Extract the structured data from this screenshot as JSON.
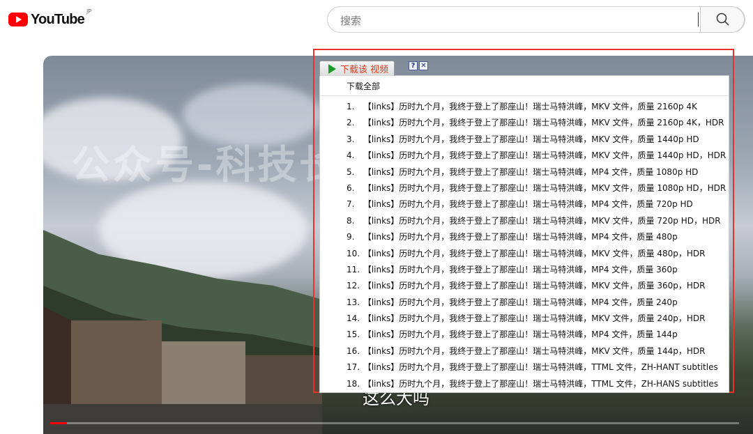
{
  "header": {
    "logo_text": "YouTube",
    "region": "JP",
    "search_placeholder": "搜索",
    "search_icon": "search-icon"
  },
  "video": {
    "watermark": "公众号-科技长青",
    "subtitle": "这么大吗",
    "progress": 0.024
  },
  "download_menu": {
    "title": "下载该 视频",
    "help_label": "?",
    "close_label": "✕",
    "all_label": "下载全部",
    "items": [
      {
        "num": "1.",
        "text": "【links】历时九个月，我终于登上了那座山！瑞士马特洪峰，MKV 文件，质量 2160p 4K"
      },
      {
        "num": "2.",
        "text": "【links】历时九个月，我终于登上了那座山！瑞士马特洪峰，MKV 文件，质量 2160p 4K，HDR"
      },
      {
        "num": "3.",
        "text": "【links】历时九个月，我终于登上了那座山！瑞士马特洪峰，MKV 文件，质量 1440p HD"
      },
      {
        "num": "4.",
        "text": "【links】历时九个月，我终于登上了那座山！瑞士马特洪峰，MKV 文件，质量 1440p HD，HDR"
      },
      {
        "num": "5.",
        "text": "【links】历时九个月，我终于登上了那座山！瑞士马特洪峰，MP4 文件，质量 1080p HD"
      },
      {
        "num": "6.",
        "text": "【links】历时九个月，我终于登上了那座山！瑞士马特洪峰，MKV 文件，质量 1080p HD，HDR"
      },
      {
        "num": "7.",
        "text": "【links】历时九个月，我终于登上了那座山！瑞士马特洪峰，MP4 文件，质量 720p HD"
      },
      {
        "num": "8.",
        "text": "【links】历时九个月，我终于登上了那座山！瑞士马特洪峰，MKV 文件，质量 720p HD，HDR"
      },
      {
        "num": "9.",
        "text": "【links】历时九个月，我终于登上了那座山！瑞士马特洪峰，MP4 文件，质量 480p"
      },
      {
        "num": "10.",
        "text": "【links】历时九个月，我终于登上了那座山！瑞士马特洪峰，MKV 文件，质量 480p，HDR"
      },
      {
        "num": "11.",
        "text": "【links】历时九个月，我终于登上了那座山！瑞士马特洪峰，MP4 文件，质量 360p"
      },
      {
        "num": "12.",
        "text": "【links】历时九个月，我终于登上了那座山！瑞士马特洪峰，MKV 文件，质量 360p，HDR"
      },
      {
        "num": "13.",
        "text": "【links】历时九个月，我终于登上了那座山！瑞士马特洪峰，MP4 文件，质量 240p"
      },
      {
        "num": "14.",
        "text": "【links】历时九个月，我终于登上了那座山！瑞士马特洪峰，MKV 文件，质量 240p，HDR"
      },
      {
        "num": "15.",
        "text": "【links】历时九个月，我终于登上了那座山！瑞士马特洪峰，MP4 文件，质量 144p"
      },
      {
        "num": "16.",
        "text": "【links】历时九个月，我终于登上了那座山！瑞士马特洪峰，MKV 文件，质量 144p，HDR"
      },
      {
        "num": "17.",
        "text": "【links】历时九个月，我终于登上了那座山！瑞士马特洪峰，TTML 文件，ZH-HANT subtitles"
      },
      {
        "num": "18.",
        "text": "【links】历时九个月，我终于登上了那座山！瑞士马特洪峰，TTML 文件，ZH-HANS subtitles"
      }
    ]
  },
  "colors": {
    "brand_red": "#ff0000",
    "highlight_frame": "#e8332b",
    "menu_title": "#d93a1a",
    "play_green": "#1a9c2a"
  }
}
